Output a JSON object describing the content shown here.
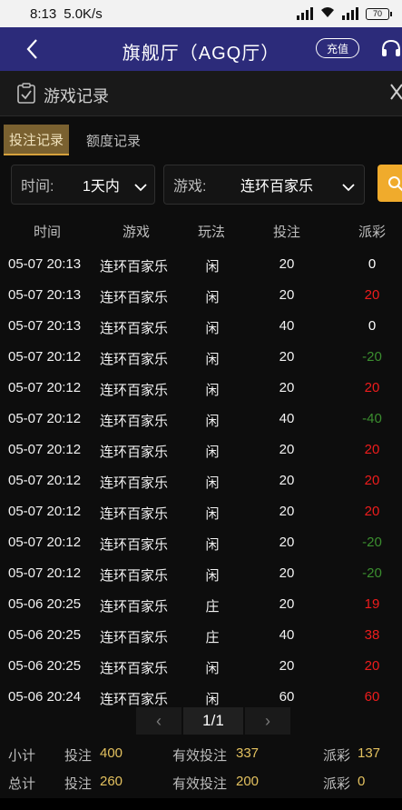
{
  "status_bar": {
    "time": "8:13",
    "speed": "5.0K/s",
    "network": "HD 4G",
    "battery": "70"
  },
  "header": {
    "title": "旗舰厅（AGQ厅）",
    "recharge_label": "充值"
  },
  "section": {
    "title": "游戏记录"
  },
  "tabs": [
    {
      "label": "投注记录",
      "active": true
    },
    {
      "label": "额度记录",
      "active": false
    }
  ],
  "filters": {
    "time_label": "时间:",
    "time_value": "1天内",
    "game_label": "游戏:",
    "game_value": "连环百家乐"
  },
  "table": {
    "columns": [
      "时间",
      "游戏",
      "玩法",
      "投注",
      "派彩"
    ],
    "rows": [
      {
        "time": "05-07 20:13",
        "game": "连环百家乐",
        "play": "闲",
        "bet": "20",
        "payout": "0",
        "status": "zero"
      },
      {
        "time": "05-07 20:13",
        "game": "连环百家乐",
        "play": "闲",
        "bet": "20",
        "payout": "20",
        "status": "win"
      },
      {
        "time": "05-07 20:13",
        "game": "连环百家乐",
        "play": "闲",
        "bet": "40",
        "payout": "0",
        "status": "zero"
      },
      {
        "time": "05-07 20:12",
        "game": "连环百家乐",
        "play": "闲",
        "bet": "20",
        "payout": "-20",
        "status": "loss"
      },
      {
        "time": "05-07 20:12",
        "game": "连环百家乐",
        "play": "闲",
        "bet": "20",
        "payout": "20",
        "status": "win"
      },
      {
        "time": "05-07 20:12",
        "game": "连环百家乐",
        "play": "闲",
        "bet": "40",
        "payout": "-40",
        "status": "loss"
      },
      {
        "time": "05-07 20:12",
        "game": "连环百家乐",
        "play": "闲",
        "bet": "20",
        "payout": "20",
        "status": "win"
      },
      {
        "time": "05-07 20:12",
        "game": "连环百家乐",
        "play": "闲",
        "bet": "20",
        "payout": "20",
        "status": "win"
      },
      {
        "time": "05-07 20:12",
        "game": "连环百家乐",
        "play": "闲",
        "bet": "20",
        "payout": "20",
        "status": "win"
      },
      {
        "time": "05-07 20:12",
        "game": "连环百家乐",
        "play": "闲",
        "bet": "20",
        "payout": "-20",
        "status": "loss"
      },
      {
        "time": "05-07 20:12",
        "game": "连环百家乐",
        "play": "闲",
        "bet": "20",
        "payout": "-20",
        "status": "loss"
      },
      {
        "time": "05-06 20:25",
        "game": "连环百家乐",
        "play": "庄",
        "bet": "20",
        "payout": "19",
        "status": "win"
      },
      {
        "time": "05-06 20:25",
        "game": "连环百家乐",
        "play": "庄",
        "bet": "40",
        "payout": "38",
        "status": "win"
      },
      {
        "time": "05-06 20:25",
        "game": "连环百家乐",
        "play": "闲",
        "bet": "20",
        "payout": "20",
        "status": "win"
      },
      {
        "time": "05-06 20:24",
        "game": "连环百家乐",
        "play": "闲",
        "bet": "60",
        "payout": "60",
        "status": "win"
      }
    ]
  },
  "pagination": {
    "prev": "‹",
    "current": "1/1",
    "next": "›"
  },
  "summary": {
    "subtotal": {
      "label": "小计",
      "bet_label": "投注",
      "bet_value": "400",
      "valid_label": "有效投注",
      "valid_value": "337",
      "payout_label": "派彩",
      "payout_value": "137"
    },
    "total": {
      "label": "总计",
      "bet_label": "投注",
      "bet_value": "260",
      "valid_label": "有效投注",
      "valid_value": "200",
      "payout_label": "派彩",
      "payout_value": "0"
    }
  },
  "colors": {
    "header_bg": "#2c2b7a",
    "accent_gold": "#f0ab2c",
    "win": "#ee1c1c",
    "loss": "#3b8e2f",
    "summary_value": "#e3c15f"
  }
}
